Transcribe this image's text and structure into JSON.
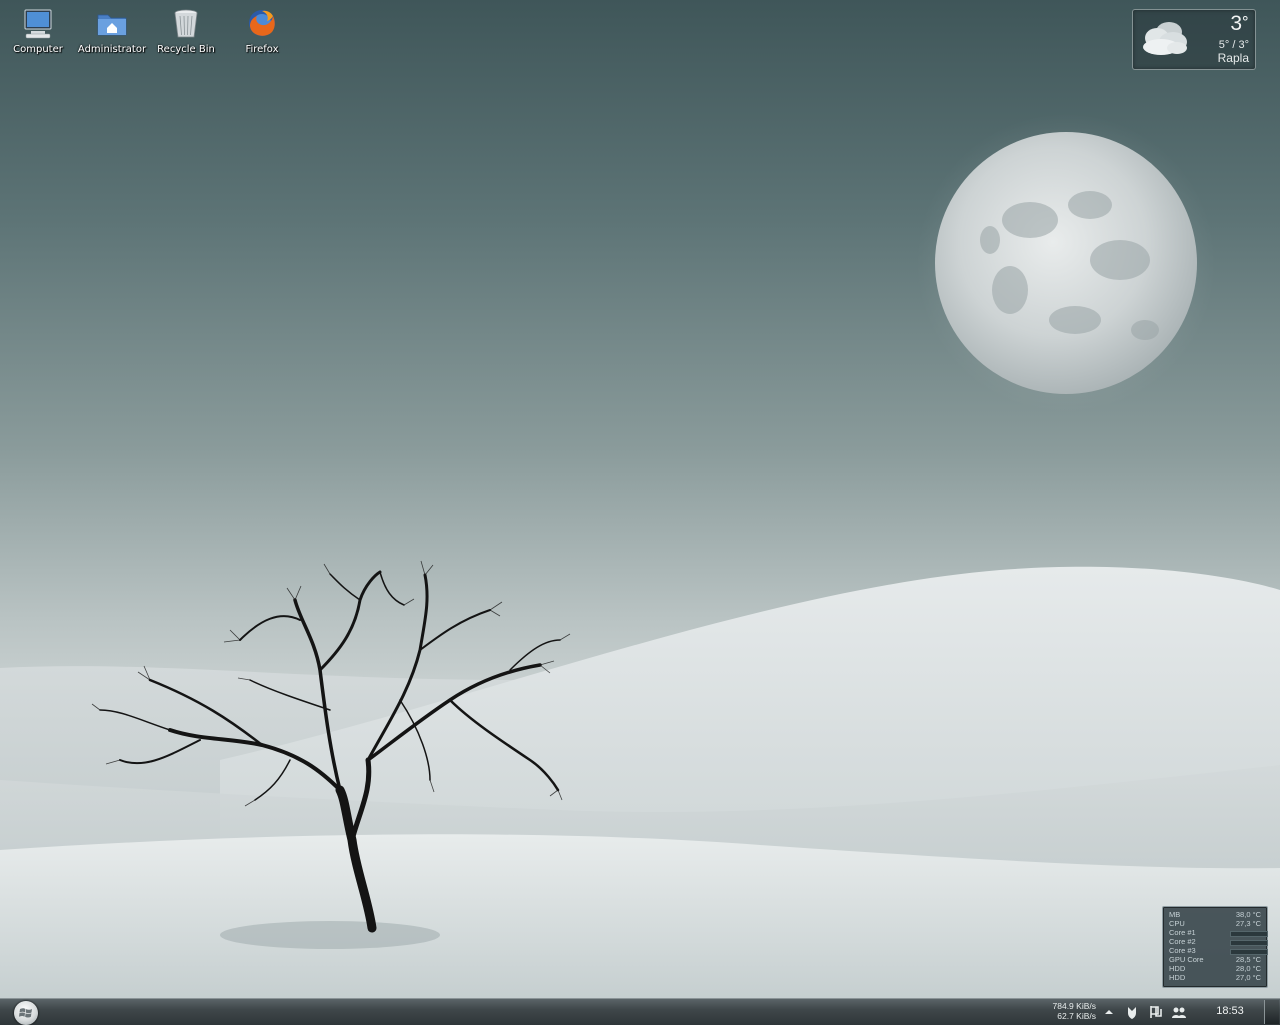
{
  "desktop_icons": [
    {
      "id": "computer",
      "label": "Computer",
      "icon": "computer-icon"
    },
    {
      "id": "administrator",
      "label": "Administrator",
      "icon": "home-folder-icon"
    },
    {
      "id": "recycle-bin",
      "label": "Recycle Bin",
      "icon": "recycle-bin-icon"
    },
    {
      "id": "firefox",
      "label": "Firefox",
      "icon": "firefox-icon"
    }
  ],
  "weather": {
    "temperature": "3",
    "degree": "°",
    "range": "5° / 3°",
    "city": "Rapla",
    "condition_icon": "cloudy-icon"
  },
  "sensors": {
    "rows": [
      {
        "name": "MB",
        "value": "38,0 °C"
      },
      {
        "name": "CPU",
        "value": "27,3 °C"
      },
      {
        "name": "Core #1",
        "bar_level": 0.05
      },
      {
        "name": "Core #2",
        "bar_level": 0.12
      },
      {
        "name": "Core #3",
        "bar_level": 0.12
      },
      {
        "name": "GPU Core",
        "value": "28,5 °C"
      },
      {
        "name": "HDD",
        "value": "28,0 °C"
      },
      {
        "name": "HDD",
        "value": "27,0 °C"
      }
    ]
  },
  "taskbar": {
    "start_icon": "windows-logo-icon",
    "net_down": "784.9 KiB/s",
    "net_up": "62.7 KiB/s",
    "tray_icons": [
      "show-hidden-icons-chevron",
      "shield-icon",
      "flag-icon",
      "network-users-icon"
    ],
    "clock": "18:53"
  },
  "colors": {
    "sky_top": "#3f5659",
    "snow": "#d5dbdb",
    "taskbar": "#3f474a"
  }
}
